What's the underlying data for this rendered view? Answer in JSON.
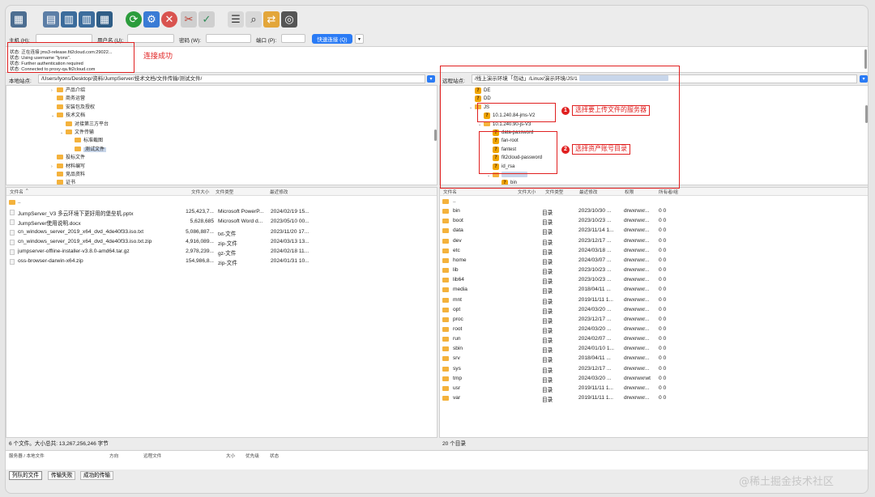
{
  "quickconnect": {
    "host_label": "主机 (H):",
    "user_label": "用户名 (U):",
    "pass_label": "密码 (W):",
    "port_label": "端口 (P):",
    "connect_label": "快速连接 (Q)",
    "dropdown_glyph": "▾"
  },
  "log": [
    "状态: 正在连接 jms3-release.fit2cloud.com:29022...",
    "状态: Using username \"lyons\".",
    "状态: Further authentication required",
    "状态: Connected to proxy-qa.fit2cloud.com"
  ],
  "local": {
    "site_label": "本地站点:",
    "path": "/Users/lyons/Desktop/资料/JumpServer/技术文档/文件传输/测试文件/",
    "tree": [
      {
        "label": "产品介绍",
        "indent": 1,
        "arrow": "›"
      },
      {
        "label": "商务运营",
        "indent": 1,
        "arrow": ""
      },
      {
        "label": "安装包及授权",
        "indent": 1,
        "arrow": ""
      },
      {
        "label": "技术文档",
        "indent": 1,
        "arrow": "⌄"
      },
      {
        "label": "对接第三方平台",
        "indent": 2,
        "arrow": ""
      },
      {
        "label": "文件传输",
        "indent": 2,
        "arrow": "⌄"
      },
      {
        "label": "标准截图",
        "indent": 3,
        "arrow": ""
      },
      {
        "label": "测试文件",
        "indent": 3,
        "arrow": "",
        "selected": true
      },
      {
        "label": "投标文件",
        "indent": 1,
        "arrow": ""
      },
      {
        "label": "材料编写",
        "indent": 1,
        "arrow": "›"
      },
      {
        "label": "竞品资料",
        "indent": 1,
        "arrow": ""
      },
      {
        "label": "证书",
        "indent": 1,
        "arrow": ""
      }
    ],
    "columns": [
      "文件名",
      "文件大小",
      "文件类型",
      "最近修改"
    ],
    "sort_glyph": "^",
    "files": [
      {
        "name": "..",
        "size": "",
        "type": "",
        "modified": "",
        "dir": true
      },
      {
        "name": "JumpServer_V3 多云环境下更好用的堡垒机.pptx",
        "size": "125,423,7...",
        "type": "Microsoft PowerP...",
        "modified": "2024/02/19 15..."
      },
      {
        "name": "JumpServer使用说明.docx",
        "size": "5,628,685",
        "type": "Microsoft Word d...",
        "modified": "2023/05/10 00..."
      },
      {
        "name": "cn_windows_server_2019_x64_dvd_4de40f33.iso.txt",
        "size": "5,086,887...",
        "type": "txt-文件",
        "modified": "2023/11/20 17..."
      },
      {
        "name": "cn_windows_server_2019_x64_dvd_4de40f33.iso.txt.zip",
        "size": "4,916,089...",
        "type": "zip-文件",
        "modified": "2024/03/13 13..."
      },
      {
        "name": "jumpserver-offline-installer-v3.8.0-amd64.tar.gz",
        "size": "2,978,239...",
        "type": "gz-文件",
        "modified": "2024/02/18 11..."
      },
      {
        "name": "oss-browser-darwin-x64.zip",
        "size": "154,986,8...",
        "type": "zip-文件",
        "modified": "2024/01/31 10..."
      }
    ],
    "status": "6 个文件。大小总共: 13,267,256,246 字节"
  },
  "remote": {
    "site_label": "远程站点:",
    "path": "/线上演示环境「勿动」/Linux/演示环境/JS/1",
    "tree": [
      {
        "label": "DE",
        "indent": 2,
        "icon": "q"
      },
      {
        "label": "DD",
        "indent": 2,
        "icon": "q"
      },
      {
        "label": "JS",
        "indent": 2,
        "arrow": "⌄",
        "icon": "folder"
      },
      {
        "label": "10.1.240.84-jms-V2",
        "indent": 3,
        "icon": "q"
      },
      {
        "label": "10.1.240.90-js-V3",
        "indent": 3,
        "arrow": "⌄",
        "icon": "folder"
      },
      {
        "label": "data-password",
        "indent": 4,
        "icon": "q"
      },
      {
        "label": "fan-root",
        "indent": 4,
        "icon": "q"
      },
      {
        "label": "fantest",
        "indent": 4,
        "icon": "q"
      },
      {
        "label": "fit2cloud-password",
        "indent": 4,
        "icon": "q"
      },
      {
        "label": "id_rsa",
        "indent": 4,
        "icon": "q"
      },
      {
        "label": "",
        "indent": 4,
        "arrow": "⌄",
        "icon": "folder",
        "blurred": true
      },
      {
        "label": "bin",
        "indent": 5,
        "icon": "q"
      }
    ],
    "columns": [
      "文件名",
      "文件大小",
      "文件类型",
      "最近修改",
      "权限",
      "所有者/组"
    ],
    "files": [
      {
        "name": "..",
        "type": "",
        "modified": "",
        "perm": "",
        "owner": ""
      },
      {
        "name": "bin",
        "type": "目录",
        "modified": "2023/10/30 ...",
        "perm": "drwxrwxr...",
        "owner": "0 0"
      },
      {
        "name": "boot",
        "type": "目录",
        "modified": "2023/10/23 ...",
        "perm": "drwxrwxr...",
        "owner": "0 0"
      },
      {
        "name": "data",
        "type": "目录",
        "modified": "2023/11/14 1...",
        "perm": "drwxrwxr...",
        "owner": "0 0"
      },
      {
        "name": "dev",
        "type": "目录",
        "modified": "2023/12/17 ...",
        "perm": "drwxrwxr...",
        "owner": "0 0"
      },
      {
        "name": "etc",
        "type": "目录",
        "modified": "2024/03/18 ...",
        "perm": "drwxrwxr...",
        "owner": "0 0"
      },
      {
        "name": "home",
        "type": "目录",
        "modified": "2024/03/07 ...",
        "perm": "drwxrwxr...",
        "owner": "0 0"
      },
      {
        "name": "lib",
        "type": "目录",
        "modified": "2023/10/23 ...",
        "perm": "drwxrwxr...",
        "owner": "0 0"
      },
      {
        "name": "lib64",
        "type": "目录",
        "modified": "2023/10/23 ...",
        "perm": "drwxrwxr...",
        "owner": "0 0"
      },
      {
        "name": "media",
        "type": "目录",
        "modified": "2018/04/11 ...",
        "perm": "drwxrwxr...",
        "owner": "0 0"
      },
      {
        "name": "mnt",
        "type": "目录",
        "modified": "2019/11/11 1...",
        "perm": "drwxrwxr...",
        "owner": "0 0"
      },
      {
        "name": "opt",
        "type": "目录",
        "modified": "2024/03/20 ...",
        "perm": "drwxrwxr...",
        "owner": "0 0"
      },
      {
        "name": "proc",
        "type": "目录",
        "modified": "2023/12/17 ...",
        "perm": "drwxrwxr...",
        "owner": "0 0"
      },
      {
        "name": "root",
        "type": "目录",
        "modified": "2024/03/20 ...",
        "perm": "drwxrwxr...",
        "owner": "0 0"
      },
      {
        "name": "run",
        "type": "目录",
        "modified": "2024/02/07 ...",
        "perm": "drwxrwxr...",
        "owner": "0 0"
      },
      {
        "name": "sbin",
        "type": "目录",
        "modified": "2024/01/10 1...",
        "perm": "drwxrwxr...",
        "owner": "0 0"
      },
      {
        "name": "srv",
        "type": "目录",
        "modified": "2018/04/11 ...",
        "perm": "drwxrwxr...",
        "owner": "0 0"
      },
      {
        "name": "sys",
        "type": "目录",
        "modified": "2023/12/17 ...",
        "perm": "drwxrwxr...",
        "owner": "0 0"
      },
      {
        "name": "tmp",
        "type": "目录",
        "modified": "2024/03/20 ...",
        "perm": "drwxrwxrwt",
        "owner": "0 0"
      },
      {
        "name": "usr",
        "type": "目录",
        "modified": "2019/11/11 1...",
        "perm": "drwxrwxr...",
        "owner": "0 0"
      },
      {
        "name": "var",
        "type": "目录",
        "modified": "2019/11/11 1...",
        "perm": "drwxrwxr...",
        "owner": "0 0"
      }
    ],
    "status": "20 个目录"
  },
  "queue": {
    "columns": [
      "服务器 / 本地文件",
      "方向",
      "远程文件",
      "大小",
      "优先级",
      "状态"
    ]
  },
  "tabs": [
    "列队的文件",
    "传输失败",
    "成功的传输"
  ],
  "annotations": {
    "connected": "连接成功",
    "step1_num": "1",
    "step1": "选择要上传文件的服务器",
    "step2_num": "2",
    "step2": "选择资产账号目录"
  },
  "watermark": "@稀土掘金技术社区",
  "colors": {
    "accent": "#2a7bf5",
    "annotation": "#e02020",
    "folder": "#f4b23c"
  }
}
